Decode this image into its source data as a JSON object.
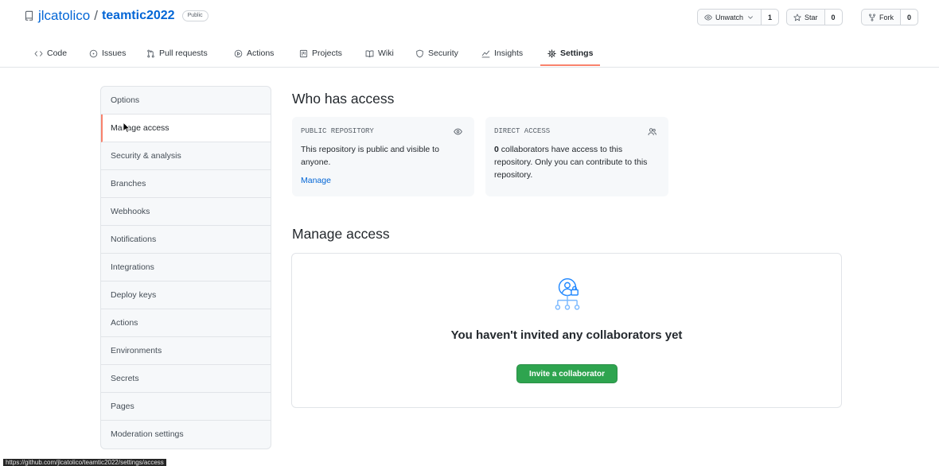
{
  "colors": {
    "accent": "#f9826c",
    "link": "#0366d6",
    "primary_button": "#2ea44f",
    "text": "#24292e",
    "muted": "#586069",
    "border": "#e1e4e8"
  },
  "repo": {
    "icon": "repo-icon",
    "owner": "jlcatolico",
    "separator": "/",
    "name": "teamtic2022",
    "visibility": "Public"
  },
  "repo_actions": {
    "watch": {
      "icon": "eye-icon",
      "label": "Unwatch",
      "count": "1"
    },
    "star": {
      "icon": "star-icon",
      "label": "Star",
      "count": "0"
    },
    "fork": {
      "icon": "fork-icon",
      "label": "Fork",
      "count": "0"
    }
  },
  "tabs": [
    {
      "label": "Code",
      "icon": "code-icon",
      "selected": false
    },
    {
      "label": "Issues",
      "icon": "issue-icon",
      "selected": false
    },
    {
      "label": "Pull requests",
      "icon": "pull-request-icon",
      "selected": false
    },
    {
      "label": "Actions",
      "icon": "play-icon",
      "selected": false
    },
    {
      "label": "Projects",
      "icon": "project-icon",
      "selected": false
    },
    {
      "label": "Wiki",
      "icon": "book-icon",
      "selected": false
    },
    {
      "label": "Security",
      "icon": "shield-icon",
      "selected": false
    },
    {
      "label": "Insights",
      "icon": "graph-icon",
      "selected": false
    },
    {
      "label": "Settings",
      "icon": "gear-icon",
      "selected": true
    }
  ],
  "sidebar": {
    "items": [
      {
        "label": "Options",
        "selected": false
      },
      {
        "label": "Manage access",
        "selected": true
      },
      {
        "label": "Security & analysis",
        "selected": false
      },
      {
        "label": "Branches",
        "selected": false
      },
      {
        "label": "Webhooks",
        "selected": false
      },
      {
        "label": "Notifications",
        "selected": false
      },
      {
        "label": "Integrations",
        "selected": false
      },
      {
        "label": "Deploy keys",
        "selected": false
      },
      {
        "label": "Actions",
        "selected": false
      },
      {
        "label": "Environments",
        "selected": false
      },
      {
        "label": "Secrets",
        "selected": false
      },
      {
        "label": "Pages",
        "selected": false
      },
      {
        "label": "Moderation settings",
        "selected": false
      }
    ]
  },
  "who_has_access": {
    "title": "Who has access",
    "public_card": {
      "label": "PUBLIC REPOSITORY",
      "icon": "eye-icon",
      "text": "This repository is public and visible to anyone.",
      "link": "Manage"
    },
    "direct_card": {
      "label": "DIRECT ACCESS",
      "icon": "people-icon",
      "count": "0",
      "text": "collaborators have access to this repository. Only you can contribute to this repository."
    }
  },
  "manage_access": {
    "title": "Manage access",
    "empty_icon": "collaborators-icon",
    "empty_message": "You haven't invited any collaborators yet",
    "invite_button": "Invite a collaborator"
  },
  "status_bar": {
    "url": "https://github.com/jlcatolico/teamtic2022/settings/access"
  }
}
